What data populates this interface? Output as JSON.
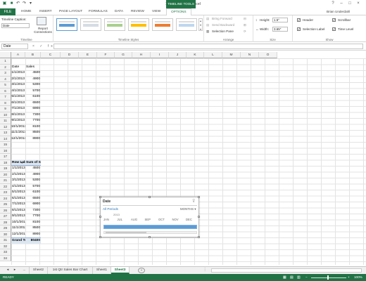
{
  "titlebar": {
    "title": "1st Qtr Sales - Excel",
    "tools_label": "TIMELINE TOOLS",
    "user": "Brian Underdahl"
  },
  "ribbon_tabs": [
    "HOME",
    "INSERT",
    "PAGE LAYOUT",
    "FORMULAS",
    "DATA",
    "REVIEW",
    "VIEW",
    "OPTIONS"
  ],
  "file_tab": "FILE",
  "ribbon": {
    "timeline_caption_label": "Timeline Caption:",
    "timeline_caption_value": "Date",
    "report_connections": "Report Connections",
    "group_timeline": "Timeline",
    "group_styles": "Timeline Styles",
    "bring_forward": "Bring Forward",
    "send_backward": "Send Backward",
    "selection_pane": "Selection Pane",
    "group_arrange": "Arrange",
    "height_label": "Height:",
    "height_value": "1.5\"",
    "width_label": "Width:",
    "width_value": "3.65\"",
    "group_size": "Size",
    "header_label": "Header",
    "scrollbar_label": "Scrollbar",
    "selection_label_label": "Selection Label",
    "time_level_label": "Time Level",
    "group_show": "Show",
    "style_colors": [
      "#5b9bd5",
      "#d6dce4",
      "#a9d08e",
      "#ffc000",
      "#ed7d31",
      "#bdd7ee"
    ]
  },
  "formula_bar": {
    "namebox": "Date",
    "fx_icons": "× ✓ fx",
    "formula": ""
  },
  "columns": [
    "A",
    "B",
    "C",
    "D",
    "E",
    "F",
    "G",
    "H",
    "I",
    "J",
    "K",
    "L",
    "M",
    "N",
    "O"
  ],
  "rows": [
    "1",
    "2",
    "3",
    "4",
    "5",
    "6",
    "7",
    "8",
    "9",
    "10",
    "11",
    "12",
    "13",
    "14",
    "15",
    "16",
    "17",
    "18",
    "19",
    "20",
    "21",
    "22",
    "23",
    "24",
    "25",
    "26",
    "27",
    "28",
    "29",
    "30",
    "31",
    "32",
    "33",
    "34"
  ],
  "data_table": {
    "header_date": "Date",
    "header_sales": "Sales",
    "dates": [
      "1/1/2013",
      "2/1/2013",
      "3/1/2013",
      "4/1/2013",
      "5/1/2013",
      "6/1/2013",
      "7/1/2013",
      "8/1/2013",
      "9/1/2013",
      "10/1/2013",
      "11/1/2013",
      "12/1/2013"
    ],
    "sales": [
      "4500",
      "4900",
      "5300",
      "5700",
      "6100",
      "6500",
      "6900",
      "7300",
      "7700",
      "8100",
      "8500",
      "8900"
    ]
  },
  "pivot": {
    "row_labels": "Row Labels",
    "sum_of_sales": "Sum of Sales",
    "dates": [
      "1/1/2013",
      "2/1/2013",
      "3/1/2013",
      "4/1/2013",
      "5/1/2013",
      "6/1/2013",
      "7/1/2013",
      "8/1/2013",
      "9/1/2013",
      "10/1/2013",
      "11/1/2013",
      "12/1/2013"
    ],
    "sales": [
      "4500",
      "4900",
      "5300",
      "5700",
      "6100",
      "6500",
      "6900",
      "7300",
      "7700",
      "8100",
      "8500",
      "8900"
    ],
    "grand_total_label": "Grand Total",
    "grand_total": "80400"
  },
  "timeline": {
    "title": "Date",
    "all_periods": "All Periods",
    "level": "MONTHS",
    "year": "2013",
    "months": [
      "JAN",
      "JUL",
      "AUG",
      "SEP",
      "OCT",
      "NOV",
      "DEC"
    ]
  },
  "sheet_tabs": [
    "...",
    "Sheet2",
    "1st Qtr Sales Bar Chart",
    "Sheet1",
    "Sheet3"
  ],
  "active_sheet": "Sheet3",
  "status": {
    "ready": "READY",
    "zoom": "100%"
  },
  "colors": {
    "excel_green": "#217346",
    "pivot_header": "#dce6f1",
    "timeline_bar": "#5b9bd5"
  }
}
